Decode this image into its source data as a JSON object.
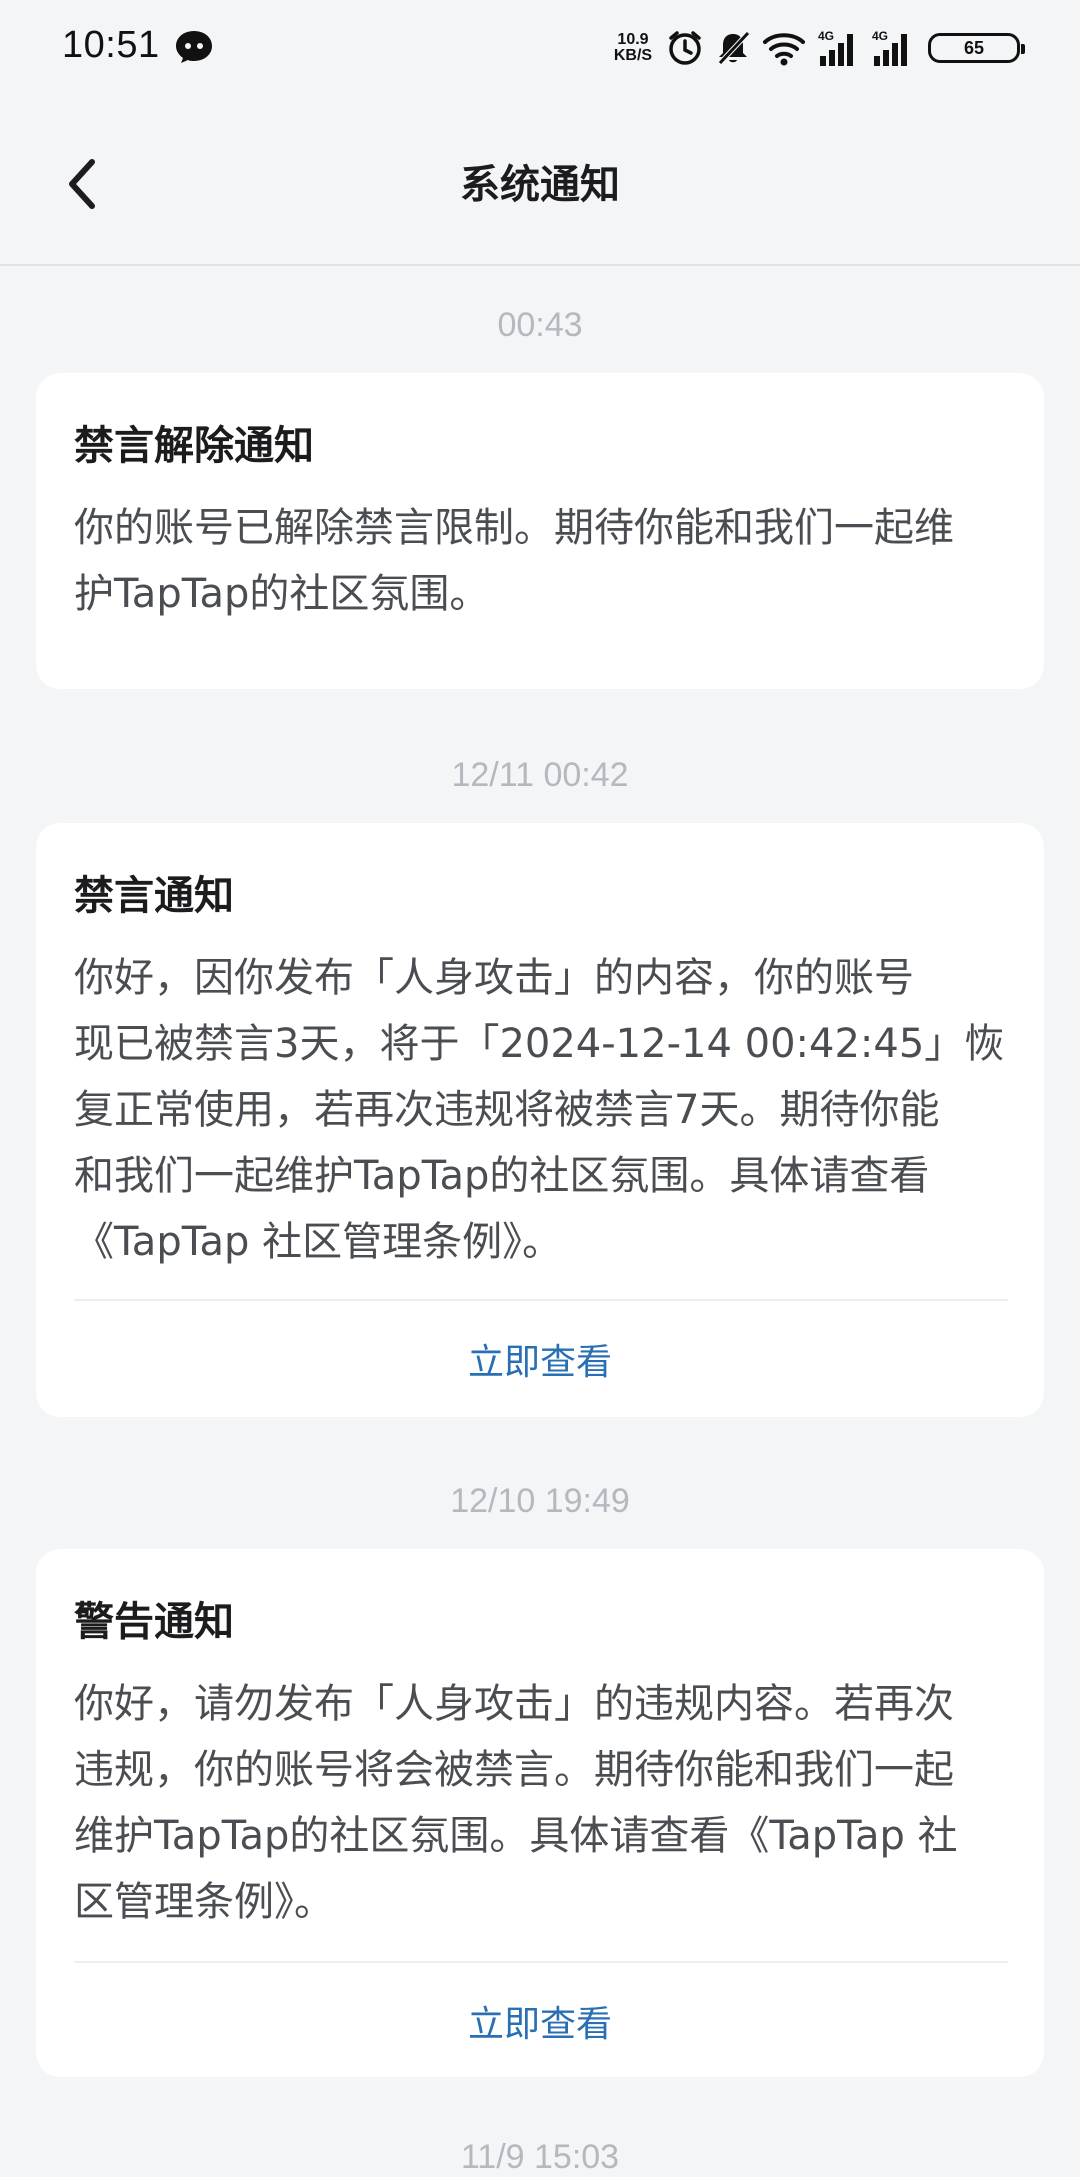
{
  "status_bar": {
    "time": "10:51",
    "net_speed_value": "10.9",
    "net_speed_unit": "KB/S",
    "signal_1_label": "4G",
    "signal_2_label": "4G",
    "battery": "65"
  },
  "header": {
    "title": "系统通知"
  },
  "notifications": [
    {
      "time": "00:43",
      "title": "禁言解除通知",
      "body": "你的账号已解除禁言限制。期待你能和我们一起维\n护TapTap的社区氛围。"
    },
    {
      "time": "12/11  00:42",
      "title": "禁言通知",
      "body": "你好，因你发布「人身攻击」的内容，你的账号\n现已被禁言3天，将于「2024-12-14 00:42:45」恢\n复正常使用，若再次违规将被禁言7天。期待你能\n和我们一起维护TapTap的社区氛围。具体请查看\n《TapTap 社区管理条例》。",
      "action": "立即查看"
    },
    {
      "time": "12/10  19:49",
      "title": "警告通知",
      "body": "你好，请勿发布「人身攻击」的违规内容。若再次\n违规，你的账号将会被禁言。期待你能和我们一起\n维护TapTap的社区氛围。具体请查看《TapTap 社\n区管理条例》。",
      "action": "立即查看"
    },
    {
      "time": "11/9  15:03"
    }
  ]
}
